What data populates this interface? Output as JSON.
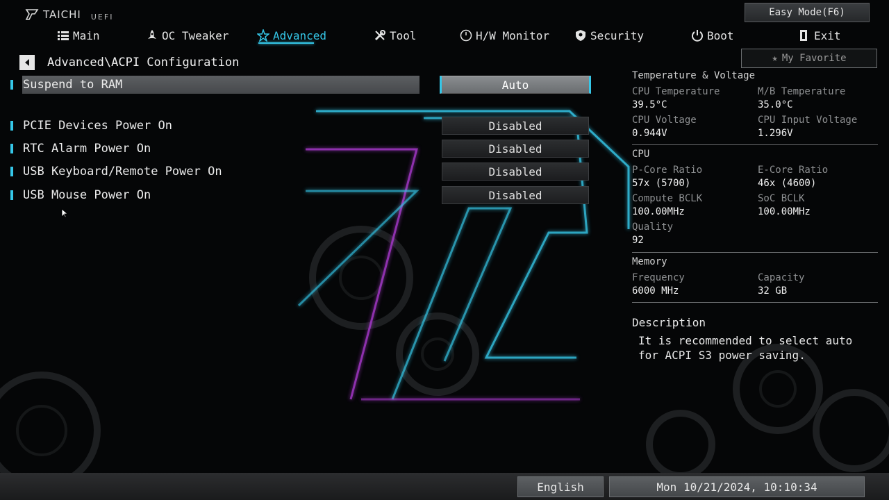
{
  "brand": {
    "name": "TAICHI",
    "sub": "UEFI"
  },
  "easy_mode_label": "Easy Mode(F6)",
  "nav": [
    {
      "label": "Main",
      "icon": "list-icon"
    },
    {
      "label": "OC Tweaker",
      "icon": "rocket-icon"
    },
    {
      "label": "Advanced",
      "icon": "star-icon",
      "active": true
    },
    {
      "label": "Tool",
      "icon": "wrench-icon"
    },
    {
      "label": "H/W Monitor",
      "icon": "monitor-icon"
    },
    {
      "label": "Security",
      "icon": "shield-icon"
    },
    {
      "label": "Boot",
      "icon": "power-icon"
    },
    {
      "label": "Exit",
      "icon": "exit-icon"
    }
  ],
  "favorite_label": "My Favorite",
  "breadcrumb": "Advanced\\ACPI Configuration",
  "settings": [
    {
      "label": "Suspend to RAM",
      "value": "Auto",
      "selected": true
    },
    {
      "label": "PCIE Devices Power On",
      "value": "Disabled"
    },
    {
      "label": "RTC Alarm Power On",
      "value": "Disabled"
    },
    {
      "label": "USB Keyboard/Remote Power On",
      "value": "Disabled"
    },
    {
      "label": "USB Mouse Power On",
      "value": "Disabled"
    }
  ],
  "hw": {
    "temp_voltage": {
      "title": "Temperature & Voltage",
      "cpu_temp_label": "CPU Temperature",
      "cpu_temp": "39.5°C",
      "mb_temp_label": "M/B Temperature",
      "mb_temp": "35.0°C",
      "cpu_volt_label": "CPU Voltage",
      "cpu_volt": "0.944V",
      "cpu_in_volt_label": "CPU Input Voltage",
      "cpu_in_volt": "1.296V"
    },
    "cpu": {
      "title": "CPU",
      "pcore_label": "P-Core Ratio",
      "pcore": "57x (5700)",
      "ecore_label": "E-Core Ratio",
      "ecore": "46x (4600)",
      "cbclk_label": "Compute BCLK",
      "cbclk": "100.00MHz",
      "socbclk_label": "SoC BCLK",
      "socbclk": "100.00MHz",
      "quality_label": "Quality",
      "quality": "92"
    },
    "memory": {
      "title": "Memory",
      "freq_label": "Frequency",
      "freq": "6000 MHz",
      "cap_label": "Capacity",
      "cap": "32 GB"
    }
  },
  "description": {
    "title": "Description",
    "text": "It is recommended to select auto for ACPI S3 power saving."
  },
  "language": "English",
  "datetime": "Mon 10/21/2024, 10:10:34",
  "colors": {
    "accent": "#35c7e8",
    "magenta": "#b43cdc"
  }
}
